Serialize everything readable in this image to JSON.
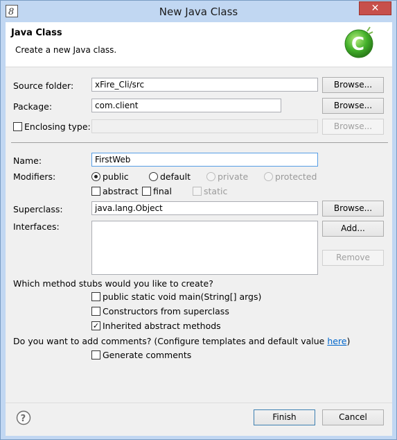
{
  "window": {
    "title": "New Java Class",
    "close_glyph": "✕"
  },
  "banner": {
    "title": "Java Class",
    "description": "Create a new Java class.",
    "icon": "class-wizard-icon"
  },
  "source_folder": {
    "label": "Source folder:",
    "value": "xFire_Cli/src",
    "browse": "Browse..."
  },
  "package": {
    "label": "Package:",
    "value": "com.client",
    "browse": "Browse..."
  },
  "enclosing_type": {
    "label": "Enclosing type:",
    "checked": false,
    "value": "",
    "browse": "Browse..."
  },
  "name": {
    "label": "Name:",
    "value": "FirstWeb"
  },
  "modifiers": {
    "label": "Modifiers:",
    "access": [
      {
        "label": "public",
        "selected": true,
        "enabled": true
      },
      {
        "label": "default",
        "selected": false,
        "enabled": true
      },
      {
        "label": "private",
        "selected": false,
        "enabled": false
      },
      {
        "label": "protected",
        "selected": false,
        "enabled": false
      }
    ],
    "flags": [
      {
        "label": "abstract",
        "checked": false,
        "enabled": true
      },
      {
        "label": "final",
        "checked": false,
        "enabled": true
      },
      {
        "label": "static",
        "checked": false,
        "enabled": false
      }
    ]
  },
  "superclass": {
    "label": "Superclass:",
    "value": "java.lang.Object",
    "browse": "Browse..."
  },
  "interfaces": {
    "label": "Interfaces:",
    "add": "Add...",
    "remove": "Remove"
  },
  "stubs": {
    "question": "Which method stubs would you like to create?",
    "options": [
      {
        "label": "public static void main(String[] args)",
        "checked": false
      },
      {
        "label": "Constructors from superclass",
        "checked": false
      },
      {
        "label": "Inherited abstract methods",
        "checked": true
      }
    ]
  },
  "comments": {
    "question": "Do you want to add comments? (Configure templates and default value ",
    "link": "here",
    "question_end": ")",
    "option": {
      "label": "Generate comments",
      "checked": false
    }
  },
  "footer": {
    "finish": "Finish",
    "cancel": "Cancel",
    "help_icon": "help-icon"
  },
  "colors": {
    "frame": "#c1d7f2",
    "close": "#c7504b",
    "link": "#0066cc",
    "banner_icon": "#43b02a"
  }
}
